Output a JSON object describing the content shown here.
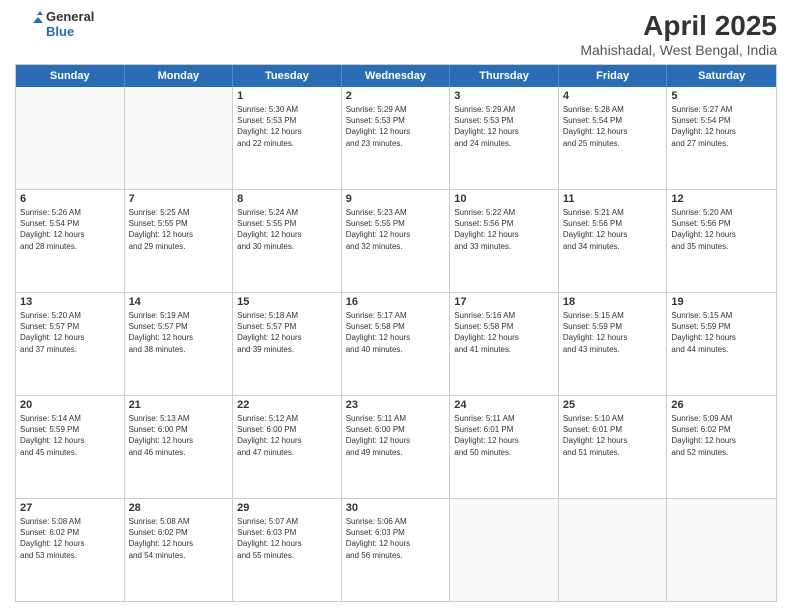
{
  "logo": {
    "line1": "General",
    "line2": "Blue"
  },
  "title": "April 2025",
  "subtitle": "Mahishadal, West Bengal, India",
  "header_days": [
    "Sunday",
    "Monday",
    "Tuesday",
    "Wednesday",
    "Thursday",
    "Friday",
    "Saturday"
  ],
  "weeks": [
    [
      {
        "day": "",
        "info": ""
      },
      {
        "day": "",
        "info": ""
      },
      {
        "day": "1",
        "info": "Sunrise: 5:30 AM\nSunset: 5:53 PM\nDaylight: 12 hours\nand 22 minutes."
      },
      {
        "day": "2",
        "info": "Sunrise: 5:29 AM\nSunset: 5:53 PM\nDaylight: 12 hours\nand 23 minutes."
      },
      {
        "day": "3",
        "info": "Sunrise: 5:29 AM\nSunset: 5:53 PM\nDaylight: 12 hours\nand 24 minutes."
      },
      {
        "day": "4",
        "info": "Sunrise: 5:28 AM\nSunset: 5:54 PM\nDaylight: 12 hours\nand 25 minutes."
      },
      {
        "day": "5",
        "info": "Sunrise: 5:27 AM\nSunset: 5:54 PM\nDaylight: 12 hours\nand 27 minutes."
      }
    ],
    [
      {
        "day": "6",
        "info": "Sunrise: 5:26 AM\nSunset: 5:54 PM\nDaylight: 12 hours\nand 28 minutes."
      },
      {
        "day": "7",
        "info": "Sunrise: 5:25 AM\nSunset: 5:55 PM\nDaylight: 12 hours\nand 29 minutes."
      },
      {
        "day": "8",
        "info": "Sunrise: 5:24 AM\nSunset: 5:55 PM\nDaylight: 12 hours\nand 30 minutes."
      },
      {
        "day": "9",
        "info": "Sunrise: 5:23 AM\nSunset: 5:55 PM\nDaylight: 12 hours\nand 32 minutes."
      },
      {
        "day": "10",
        "info": "Sunrise: 5:22 AM\nSunset: 5:56 PM\nDaylight: 12 hours\nand 33 minutes."
      },
      {
        "day": "11",
        "info": "Sunrise: 5:21 AM\nSunset: 5:56 PM\nDaylight: 12 hours\nand 34 minutes."
      },
      {
        "day": "12",
        "info": "Sunrise: 5:20 AM\nSunset: 5:56 PM\nDaylight: 12 hours\nand 35 minutes."
      }
    ],
    [
      {
        "day": "13",
        "info": "Sunrise: 5:20 AM\nSunset: 5:57 PM\nDaylight: 12 hours\nand 37 minutes."
      },
      {
        "day": "14",
        "info": "Sunrise: 5:19 AM\nSunset: 5:57 PM\nDaylight: 12 hours\nand 38 minutes."
      },
      {
        "day": "15",
        "info": "Sunrise: 5:18 AM\nSunset: 5:57 PM\nDaylight: 12 hours\nand 39 minutes."
      },
      {
        "day": "16",
        "info": "Sunrise: 5:17 AM\nSunset: 5:58 PM\nDaylight: 12 hours\nand 40 minutes."
      },
      {
        "day": "17",
        "info": "Sunrise: 5:16 AM\nSunset: 5:58 PM\nDaylight: 12 hours\nand 41 minutes."
      },
      {
        "day": "18",
        "info": "Sunrise: 5:15 AM\nSunset: 5:59 PM\nDaylight: 12 hours\nand 43 minutes."
      },
      {
        "day": "19",
        "info": "Sunrise: 5:15 AM\nSunset: 5:59 PM\nDaylight: 12 hours\nand 44 minutes."
      }
    ],
    [
      {
        "day": "20",
        "info": "Sunrise: 5:14 AM\nSunset: 5:59 PM\nDaylight: 12 hours\nand 45 minutes."
      },
      {
        "day": "21",
        "info": "Sunrise: 5:13 AM\nSunset: 6:00 PM\nDaylight: 12 hours\nand 46 minutes."
      },
      {
        "day": "22",
        "info": "Sunrise: 5:12 AM\nSunset: 6:00 PM\nDaylight: 12 hours\nand 47 minutes."
      },
      {
        "day": "23",
        "info": "Sunrise: 5:11 AM\nSunset: 6:00 PM\nDaylight: 12 hours\nand 49 minutes."
      },
      {
        "day": "24",
        "info": "Sunrise: 5:11 AM\nSunset: 6:01 PM\nDaylight: 12 hours\nand 50 minutes."
      },
      {
        "day": "25",
        "info": "Sunrise: 5:10 AM\nSunset: 6:01 PM\nDaylight: 12 hours\nand 51 minutes."
      },
      {
        "day": "26",
        "info": "Sunrise: 5:09 AM\nSunset: 6:02 PM\nDaylight: 12 hours\nand 52 minutes."
      }
    ],
    [
      {
        "day": "27",
        "info": "Sunrise: 5:08 AM\nSunset: 6:02 PM\nDaylight: 12 hours\nand 53 minutes."
      },
      {
        "day": "28",
        "info": "Sunrise: 5:08 AM\nSunset: 6:02 PM\nDaylight: 12 hours\nand 54 minutes."
      },
      {
        "day": "29",
        "info": "Sunrise: 5:07 AM\nSunset: 6:03 PM\nDaylight: 12 hours\nand 55 minutes."
      },
      {
        "day": "30",
        "info": "Sunrise: 5:06 AM\nSunset: 6:03 PM\nDaylight: 12 hours\nand 56 minutes."
      },
      {
        "day": "",
        "info": ""
      },
      {
        "day": "",
        "info": ""
      },
      {
        "day": "",
        "info": ""
      }
    ]
  ]
}
